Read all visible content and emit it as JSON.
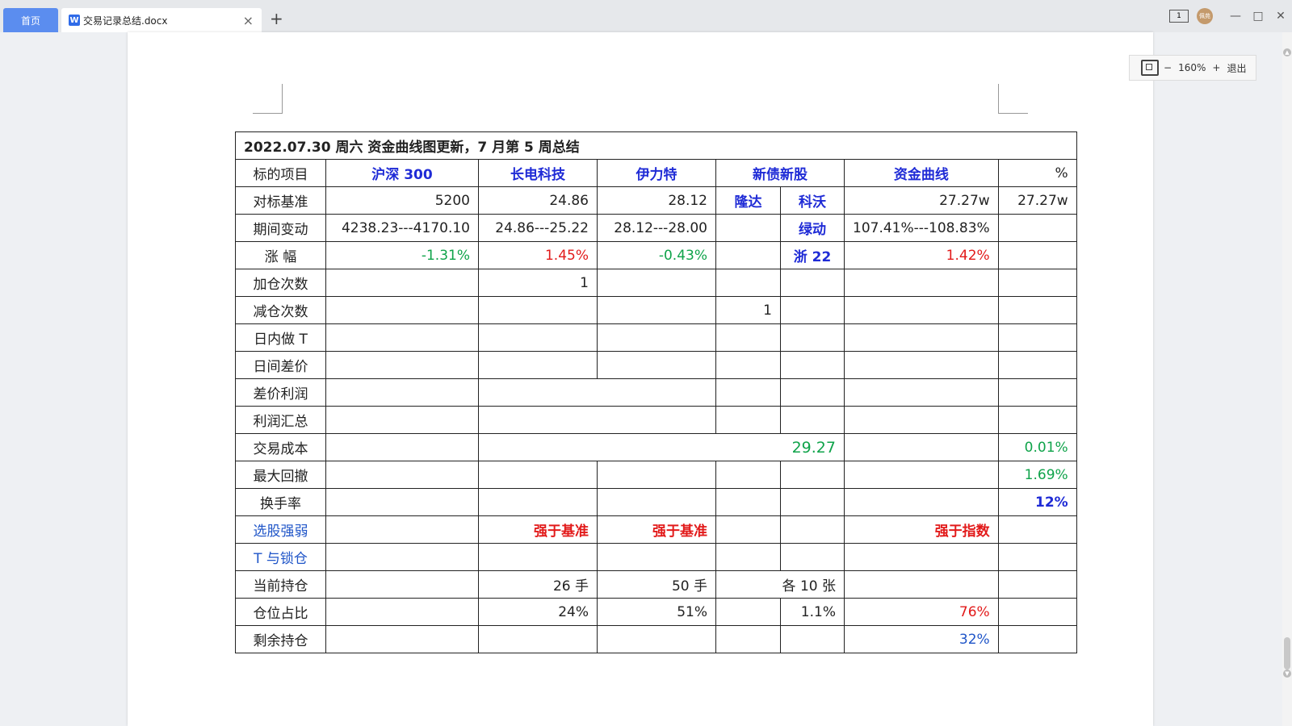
{
  "tabs": {
    "home_label": "首页",
    "doc_title": "交易记录总结.docx",
    "doc_icon": "W",
    "close_glyph": "×",
    "add_glyph": "+"
  },
  "window": {
    "layout_badge": "1",
    "avatar_text": "佩苑",
    "minimize": "—",
    "maximize": "□",
    "close": "✕"
  },
  "zoom": {
    "minus": "−",
    "level": "160%",
    "plus": "+",
    "exit_label": "退出"
  },
  "table": {
    "title": "2022.07.30 周六 资金曲线图更新，7 月第 5 周总结",
    "header": {
      "label": "标的项目",
      "c1": "沪深 300",
      "c2": "长电科技",
      "c3": "伊力特",
      "c4": "新债新股",
      "c5": "资金曲线",
      "c6": "%"
    },
    "benchmark": {
      "label": "对标基准",
      "c1": "5200",
      "c2": "24.86",
      "c3": "28.12",
      "c4a": "隆达",
      "c4b": "科沃",
      "c5": "27.27w",
      "c6": "27.27w"
    },
    "change": {
      "label": "期间变动",
      "c1": "4238.23---4170.10",
      "c2": "24.86---25.22",
      "c3": "28.12---28.00",
      "c4b": "绿动",
      "c5": "107.41%---108.83%"
    },
    "gain": {
      "label": "涨  幅",
      "c1": "-1.31%",
      "c2": "1.45%",
      "c3": "-0.43%",
      "c4b": "浙 22",
      "c5": "1.42%"
    },
    "add_count": {
      "label": "加仓次数",
      "c2": "1"
    },
    "reduce_count": {
      "label": "减仓次数",
      "c4a": "1"
    },
    "intraday_t": {
      "label": "日内做 T"
    },
    "interday": {
      "label": "日间差价"
    },
    "spread_profit": {
      "label": "差价利润"
    },
    "profit_total": {
      "label": "利润汇总"
    },
    "cost": {
      "label": "交易成本",
      "value": "29.27",
      "pct": "0.01%"
    },
    "drawdown": {
      "label": "最大回撤",
      "pct": "1.69%"
    },
    "turnover": {
      "label": "换手率",
      "pct": "12%"
    },
    "pick_strength": {
      "label": "选股强弱",
      "c2": "强于基准",
      "c3": "强于基准",
      "c5": "强于指数"
    },
    "t_lock": {
      "label": "T 与锁仓"
    },
    "position": {
      "label": "当前持仓",
      "c2": "26 手",
      "c3": "50 手",
      "c4": "各 10 张"
    },
    "ratio": {
      "label": "仓位占比",
      "c2": "24%",
      "c3": "51%",
      "c4b": "1.1%",
      "c5": "76%"
    },
    "remaining": {
      "label": "剩余持仓",
      "c5": "32%"
    }
  }
}
